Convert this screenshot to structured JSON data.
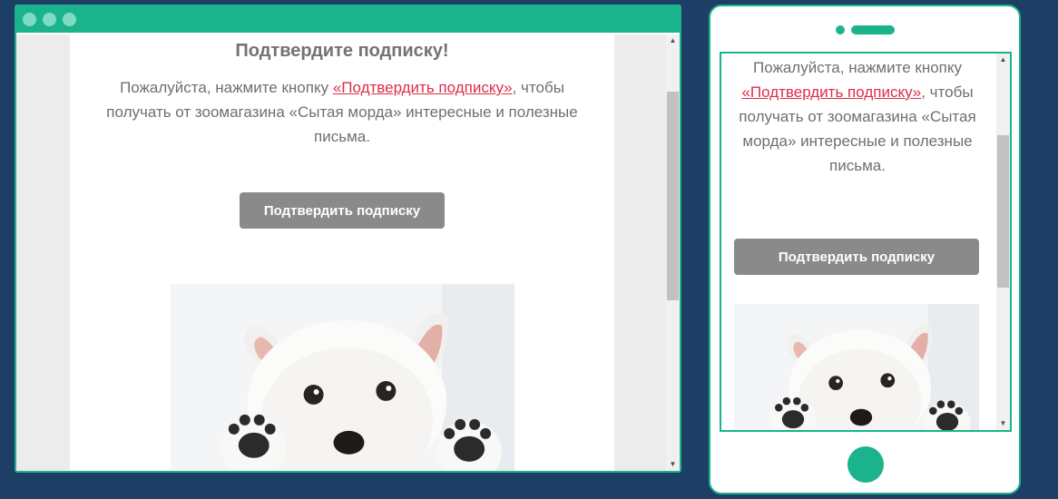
{
  "colors": {
    "page_background": "#1d3f66",
    "accent": "#1bb38c",
    "link": "#dc2e4a",
    "button": "#8a8a8a",
    "text": "#6f6f6f"
  },
  "email": {
    "title": "Подтвердите подписку!",
    "text_before_link": "Пожалуйста, нажмите кнопку ",
    "link_text": "«Подтвердить подписку»",
    "text_after_link": ", чтобы получать от зоомагазина «Сытая морда» интересные и полезные письма.",
    "button_label": "Подтвердить подписку",
    "image": "puppy-photo"
  },
  "scrollbar": {
    "up_arrow": "▲",
    "down_arrow": "▼"
  }
}
